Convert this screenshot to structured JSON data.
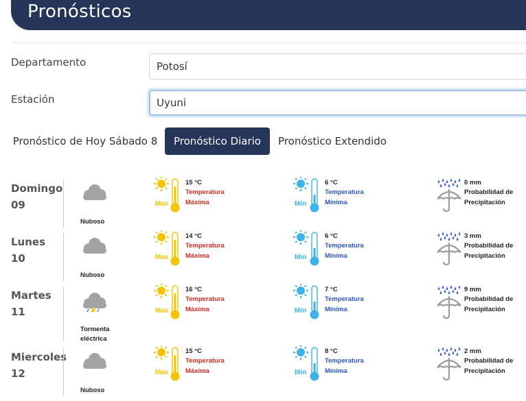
{
  "header": {
    "title": "Pronósticos"
  },
  "form": {
    "departamento_label": "Departamento",
    "departamento_value": "Potosí",
    "estacion_label": "Estación",
    "estacion_value": "Uyuni"
  },
  "tabs": [
    {
      "label": "Pronóstico de Hoy Sábado 8",
      "active": false
    },
    {
      "label": "Pronóstico Diario",
      "active": true
    },
    {
      "label": "Pronóstico Extendido",
      "active": false
    }
  ],
  "labels": {
    "max_1": "Temperatura",
    "max_2": "Máxima",
    "min_1": "Temperatura",
    "min_2": "Mínima",
    "precip_1": "Probabilidad de",
    "precip_2": "Precipitación",
    "max_icon_text": "Max",
    "min_icon_text": "Min"
  },
  "days": [
    {
      "name": "Domingo",
      "num": "09",
      "condition": "Nuboso",
      "max": "15 °C",
      "min": "6 °C",
      "precip": "0 mm"
    },
    {
      "name": "Lunes",
      "num": "10",
      "condition": "Nuboso",
      "max": "14 °C",
      "min": "6 °C",
      "precip": "3 mm"
    },
    {
      "name": "Martes",
      "num": "11",
      "condition": "Tormenta eléctrica",
      "max": "16 °C",
      "min": "7 °C",
      "precip": "9 mm"
    },
    {
      "name": "Miercoles",
      "num": "12",
      "condition": "Nuboso",
      "max": "15 °C",
      "min": "8 °C",
      "precip": "2 mm"
    }
  ],
  "colors": {
    "header": "#253559",
    "max_text": "#e02a21",
    "min_text": "#2b55c9",
    "sun": "#f5c400",
    "cold_sun": "#3fb2e6"
  },
  "icons": [
    "cloud-icon",
    "storm-cloud-icon",
    "sun-icon",
    "thermometer-icon",
    "rain-icon",
    "umbrella-icon"
  ]
}
